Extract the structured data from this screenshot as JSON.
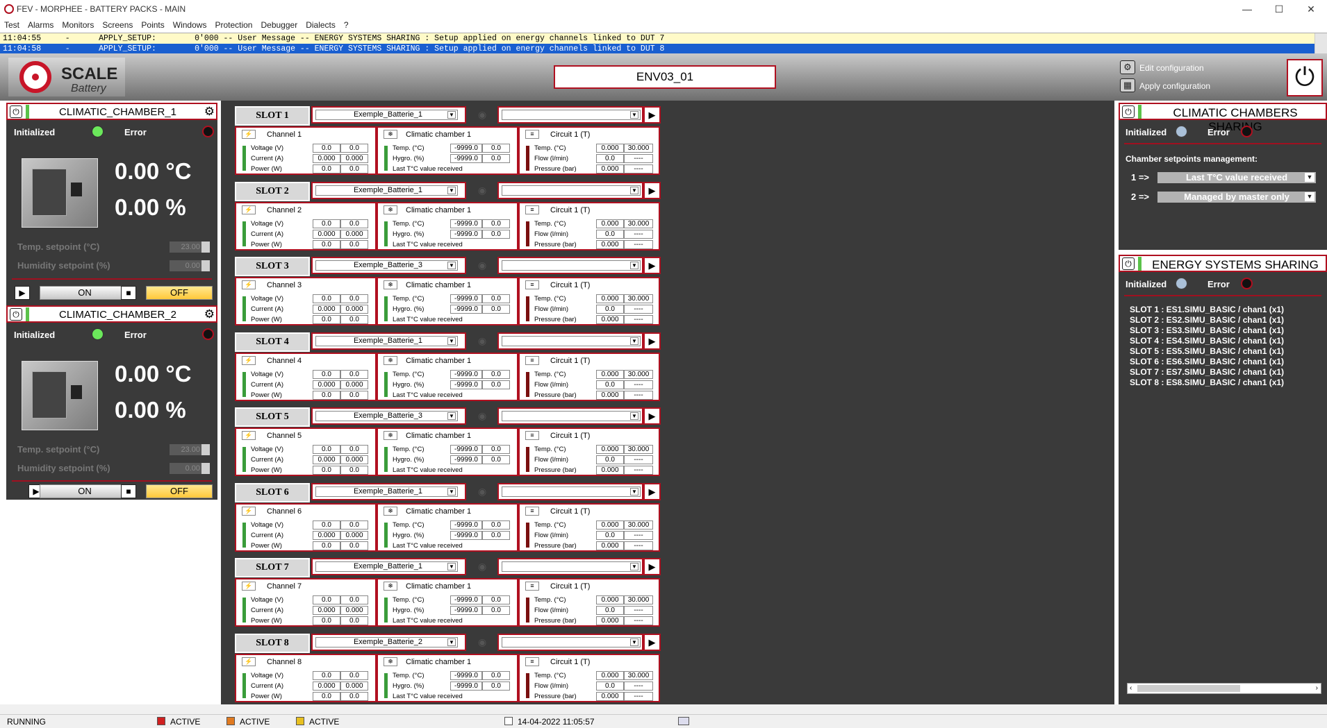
{
  "window": {
    "title": "FEV - MORPHEE - BATTERY PACKS - MAIN",
    "minimize": "—",
    "maximize": "☐",
    "close": "✕"
  },
  "menu": [
    "Test",
    "Alarms",
    "Monitors",
    "Screens",
    "Points",
    "Windows",
    "Protection",
    "Debugger",
    "Dialects",
    "?"
  ],
  "messages": [
    {
      "time": "11:04:55",
      "sep": "-",
      "type": "APPLY_SETUP:",
      "text": "0'000 -- User Message -- ENERGY SYSTEMS SHARING : Setup applied on energy channels linked to DUT 7"
    },
    {
      "time": "11:04:58",
      "sep": "-",
      "type": "APPLY_SETUP:",
      "text": "0'000 -- User Message -- ENERGY SYSTEMS SHARING : Setup applied on energy channels linked to DUT 8"
    }
  ],
  "header": {
    "logo_title": "SCALE",
    "logo_sub": "Battery",
    "env_name": "ENV03_01",
    "edit_config": "Edit configuration",
    "apply_config": "Apply configuration"
  },
  "chambers": [
    {
      "name": "CLIMATIC_CHAMBER_1",
      "initialized": "Initialized",
      "error": "Error",
      "temp": "0.00 °C",
      "hum": "0.00 %",
      "temp_sp_label": "Temp. setpoint (°C)",
      "temp_sp": "23.00",
      "hum_sp_label": "Humidity setpoint (%)",
      "hum_sp": "0.00",
      "on": "ON",
      "off": "OFF"
    },
    {
      "name": "CLIMATIC_CHAMBER_2",
      "initialized": "Initialized",
      "error": "Error",
      "temp": "0.00 °C",
      "hum": "0.00 %",
      "temp_sp_label": "Temp. setpoint (°C)",
      "temp_sp": "23.00",
      "hum_sp_label": "Humidity setpoint (%)",
      "hum_sp": "0.00",
      "on": "ON",
      "off": "OFF"
    }
  ],
  "labels": {
    "voltage": "Voltage (V)",
    "current": "Current (A)",
    "power": "Power (W)",
    "ctemp": "Temp. (°C)",
    "hygro": "Hygro. (%)",
    "last": "Last T°C value received",
    "ftemp": "Temp. (°C)",
    "flow": "Flow (l/min)",
    "pressure": "Pressure (bar)",
    "chamber_title": "Climatic chamber 1",
    "circuit_title": "Circuit 1 (T)"
  },
  "slots": [
    {
      "label": "SLOT 1",
      "battery": "Exemple_Batterie_1",
      "channel": "Channel 1",
      "v": [
        "0.0",
        "0.0"
      ],
      "i": [
        "0.000",
        "0.000"
      ],
      "p": [
        "0.0",
        "0.0"
      ],
      "ct": [
        "-9999.0",
        "0.0"
      ],
      "ch": [
        "-9999.0",
        "0.0"
      ],
      "ft": [
        "0.000",
        "30.000"
      ],
      "ff": [
        "0.0",
        "----"
      ],
      "fp": [
        "0.000",
        "----"
      ]
    },
    {
      "label": "SLOT 2",
      "battery": "Exemple_Batterie_1",
      "channel": "Channel 2",
      "v": [
        "0.0",
        "0.0"
      ],
      "i": [
        "0.000",
        "0.000"
      ],
      "p": [
        "0.0",
        "0.0"
      ],
      "ct": [
        "-9999.0",
        "0.0"
      ],
      "ch": [
        "-9999.0",
        "0.0"
      ],
      "ft": [
        "0.000",
        "30.000"
      ],
      "ff": [
        "0.0",
        "----"
      ],
      "fp": [
        "0.000",
        "----"
      ]
    },
    {
      "label": "SLOT 3",
      "battery": "Exemple_Batterie_3",
      "channel": "Channel 3",
      "v": [
        "0.0",
        "0.0"
      ],
      "i": [
        "0.000",
        "0.000"
      ],
      "p": [
        "0.0",
        "0.0"
      ],
      "ct": [
        "-9999.0",
        "0.0"
      ],
      "ch": [
        "-9999.0",
        "0.0"
      ],
      "ft": [
        "0.000",
        "30.000"
      ],
      "ff": [
        "0.0",
        "----"
      ],
      "fp": [
        "0.000",
        "----"
      ]
    },
    {
      "label": "SLOT 4",
      "battery": "Exemple_Batterie_1",
      "channel": "Channel 4",
      "v": [
        "0.0",
        "0.0"
      ],
      "i": [
        "0.000",
        "0.000"
      ],
      "p": [
        "0.0",
        "0.0"
      ],
      "ct": [
        "-9999.0",
        "0.0"
      ],
      "ch": [
        "-9999.0",
        "0.0"
      ],
      "ft": [
        "0.000",
        "30.000"
      ],
      "ff": [
        "0.0",
        "----"
      ],
      "fp": [
        "0.000",
        "----"
      ]
    },
    {
      "label": "SLOT 5",
      "battery": "Exemple_Batterie_3",
      "channel": "Channel 5",
      "v": [
        "0.0",
        "0.0"
      ],
      "i": [
        "0.000",
        "0.000"
      ],
      "p": [
        "0.0",
        "0.0"
      ],
      "ct": [
        "-9999.0",
        "0.0"
      ],
      "ch": [
        "-9999.0",
        "0.0"
      ],
      "ft": [
        "0.000",
        "30.000"
      ],
      "ff": [
        "0.0",
        "----"
      ],
      "fp": [
        "0.000",
        "----"
      ]
    },
    {
      "label": "SLOT 6",
      "battery": "Exemple_Batterie_1",
      "channel": "Channel 6",
      "v": [
        "0.0",
        "0.0"
      ],
      "i": [
        "0.000",
        "0.000"
      ],
      "p": [
        "0.0",
        "0.0"
      ],
      "ct": [
        "-9999.0",
        "0.0"
      ],
      "ch": [
        "-9999.0",
        "0.0"
      ],
      "ft": [
        "0.000",
        "30.000"
      ],
      "ff": [
        "0.0",
        "----"
      ],
      "fp": [
        "0.000",
        "----"
      ]
    },
    {
      "label": "SLOT 7",
      "battery": "Exemple_Batterie_1",
      "channel": "Channel 7",
      "v": [
        "0.0",
        "0.0"
      ],
      "i": [
        "0.000",
        "0.000"
      ],
      "p": [
        "0.0",
        "0.0"
      ],
      "ct": [
        "-9999.0",
        "0.0"
      ],
      "ch": [
        "-9999.0",
        "0.0"
      ],
      "ft": [
        "0.000",
        "30.000"
      ],
      "ff": [
        "0.0",
        "----"
      ],
      "fp": [
        "0.000",
        "----"
      ]
    },
    {
      "label": "SLOT 8",
      "battery": "Exemple_Batterie_2",
      "channel": "Channel 8",
      "v": [
        "0.0",
        "0.0"
      ],
      "i": [
        "0.000",
        "0.000"
      ],
      "p": [
        "0.0",
        "0.0"
      ],
      "ct": [
        "-9999.0",
        "0.0"
      ],
      "ch": [
        "-9999.0",
        "0.0"
      ],
      "ft": [
        "0.000",
        "30.000"
      ],
      "ff": [
        "0.0",
        "----"
      ],
      "fp": [
        "0.000",
        "----"
      ]
    }
  ],
  "ccs": {
    "title": "CLIMATIC CHAMBERS SHARING",
    "initialized": "Initialized",
    "error": "Error",
    "mgmt_label": "Chamber setpoints management:",
    "rows": [
      {
        "idx": "1 =>",
        "value": "Last T°C value received"
      },
      {
        "idx": "2 =>",
        "value": "Managed by master only"
      }
    ]
  },
  "ess": {
    "title": "ENERGY SYSTEMS SHARING",
    "initialized": "Initialized",
    "error": "Error",
    "items": [
      "SLOT 1 : ES1.SIMU_BASIC / chan1 (x1)",
      "SLOT 2 : ES2.SIMU_BASIC / chan1 (x1)",
      "SLOT 3 : ES3.SIMU_BASIC / chan1 (x1)",
      "SLOT 4 : ES4.SIMU_BASIC / chan1 (x1)",
      "SLOT 5 : ES5.SIMU_BASIC / chan1 (x1)",
      "SLOT 6 : ES6.SIMU_BASIC / chan1 (x1)",
      "SLOT 7 : ES7.SIMU_BASIC / chan1 (x1)",
      "SLOT 8 : ES8.SIMU_BASIC / chan1 (x1)"
    ]
  },
  "status": {
    "state": "RUNNING",
    "a1": "ACTIVE",
    "a2": "ACTIVE",
    "a3": "ACTIVE",
    "datetime": "14-04-2022 11:05:57"
  },
  "colors": {
    "accent": "#b01020",
    "panel": "#3a3a3a",
    "selection": "#1a5fd0",
    "msg_bg": "#fffac8"
  }
}
